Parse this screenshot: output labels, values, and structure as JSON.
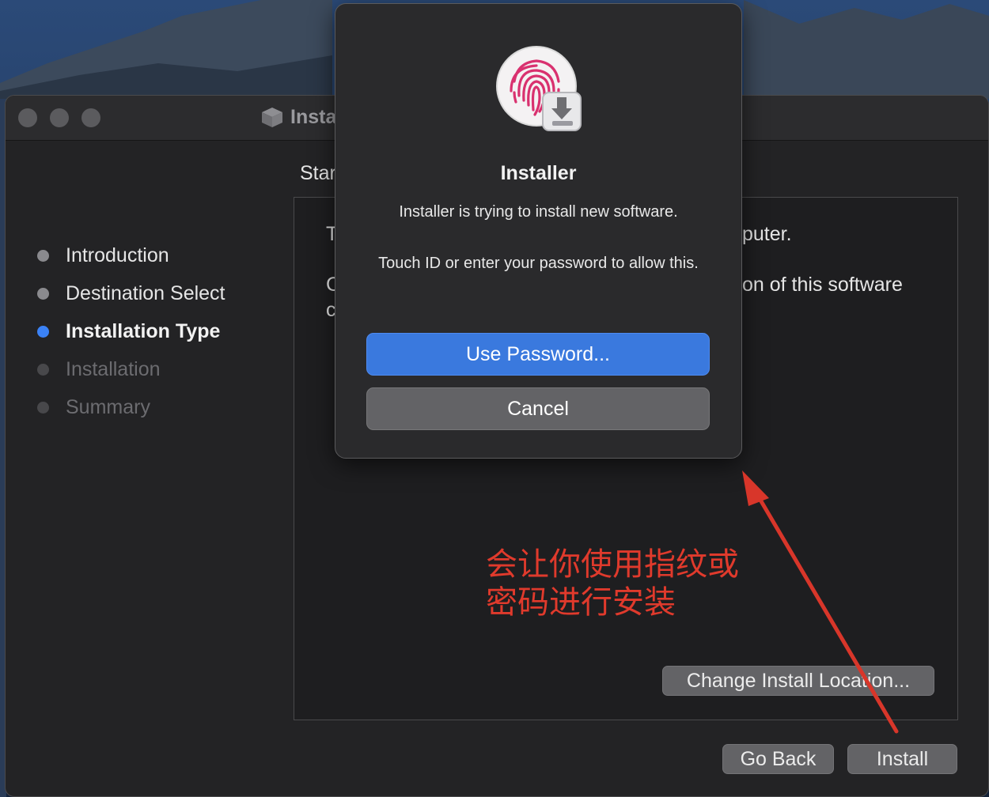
{
  "window": {
    "title": "Installer"
  },
  "sidebar": {
    "steps": [
      {
        "label": "Introduction",
        "state": "done"
      },
      {
        "label": "Destination Select",
        "state": "done"
      },
      {
        "label": "Installation Type",
        "state": "current"
      },
      {
        "label": "Installation",
        "state": "pending"
      },
      {
        "label": "Summary",
        "state": "pending"
      }
    ]
  },
  "pane": {
    "heading_visible": "Star",
    "line1_left": "T",
    "line1_right": "puter.",
    "line2_left": "C",
    "line2_right": "on of this software",
    "line3_left": "c",
    "change_location_label": "Change Install Location..."
  },
  "footer": {
    "go_back_label": "Go Back",
    "install_label": "Install"
  },
  "dialog": {
    "title": "Installer",
    "message": "Installer is trying to install new software.",
    "info": "Touch ID or enter your password to allow this.",
    "use_password_label": "Use Password...",
    "cancel_label": "Cancel",
    "icon": "touch-id-fingerprint-icon"
  },
  "annotation": {
    "line1": "会让你使用指纹或",
    "line2": "密码进行安装",
    "color": "#e03a2c"
  },
  "colors": {
    "accent": "#3b82f6",
    "primary_button": "#3a79de",
    "window_bg": "#232325"
  }
}
